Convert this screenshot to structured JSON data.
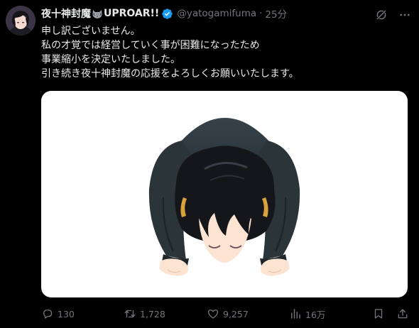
{
  "author": {
    "display_name": "夜十神封魔",
    "badge_text": "UPROAR!!",
    "handle": "@yatogamifuma",
    "separator": "·",
    "time": "25分"
  },
  "tweet": {
    "lines": [
      "申し訳ございません。",
      "私の才覚では経営していく事が困難になったため",
      "事業縮小を決定いたしました。",
      "引き続き夜十神封魔の応援をよろしくお願いいたします。"
    ]
  },
  "actions": {
    "replies": "130",
    "reposts": "1,728",
    "likes": "9,257",
    "views": "16万"
  },
  "icons": {
    "name_emoji": "raccoon-icon",
    "verified": "verified-badge-icon",
    "top_left_action": "grok-icon",
    "top_right_action": "more-icon",
    "reply": "reply-icon",
    "repost": "repost-icon",
    "like": "like-icon",
    "views": "views-icon",
    "bookmark": "bookmark-icon",
    "share": "share-icon"
  },
  "colors": {
    "background": "#000000",
    "text_primary": "#e7e9ea",
    "text_secondary": "#71767b",
    "verified_blue": "#1d9bf0",
    "media_background": "#ffffff",
    "suit": "#2b3539",
    "hair": "#15161a",
    "skin": "#fde4d2"
  }
}
